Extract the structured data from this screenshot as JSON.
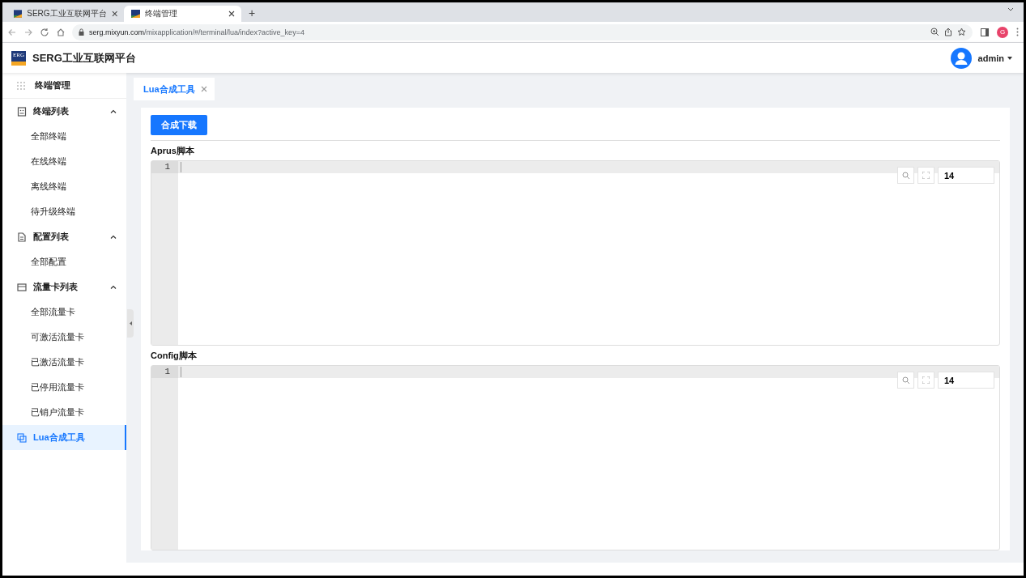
{
  "browser": {
    "tabs": [
      {
        "title": "SERG工业互联网平台",
        "selected": false
      },
      {
        "title": "终端管理",
        "selected": true
      }
    ],
    "new_tab": "+",
    "address": {
      "host": "serg.mixyun.com",
      "path": "/mixapplication/#/terminal/lua/index?active_key=4"
    },
    "profile": "G"
  },
  "header": {
    "logo": "ERG",
    "title": "SERG工业互联网平台",
    "user": "admin"
  },
  "sidebar": {
    "title": "终端管理",
    "items": [
      {
        "kind": "group",
        "label": "终端列表",
        "expanded": true,
        "children": [
          {
            "label": "全部终端",
            "selected": false
          },
          {
            "label": "在线终端",
            "selected": false
          },
          {
            "label": "离线终端",
            "selected": false
          },
          {
            "label": "待升级终端",
            "selected": false
          }
        ]
      },
      {
        "kind": "group",
        "label": "配置列表",
        "expanded": true,
        "children": [
          {
            "label": "全部配置",
            "selected": false
          }
        ]
      },
      {
        "kind": "group",
        "label": "流量卡列表",
        "expanded": true,
        "children": [
          {
            "label": "全部流量卡",
            "selected": false
          },
          {
            "label": "可激活流量卡",
            "selected": false
          },
          {
            "label": "已激活流量卡",
            "selected": false
          },
          {
            "label": "已停用流量卡",
            "selected": false
          },
          {
            "label": "已销户流量卡",
            "selected": false
          }
        ]
      },
      {
        "kind": "item",
        "label": "Lua合成工具",
        "selected": true
      }
    ]
  },
  "page_tabs": [
    {
      "label": "Lua合成工具",
      "selected": true
    }
  ],
  "toolbar": {
    "button": "合成下载"
  },
  "editors": [
    {
      "label": "Aprus脚本",
      "line_number": "1",
      "font_size": "14"
    },
    {
      "label": "Config脚本",
      "line_number": "1",
      "font_size": "14"
    }
  ]
}
